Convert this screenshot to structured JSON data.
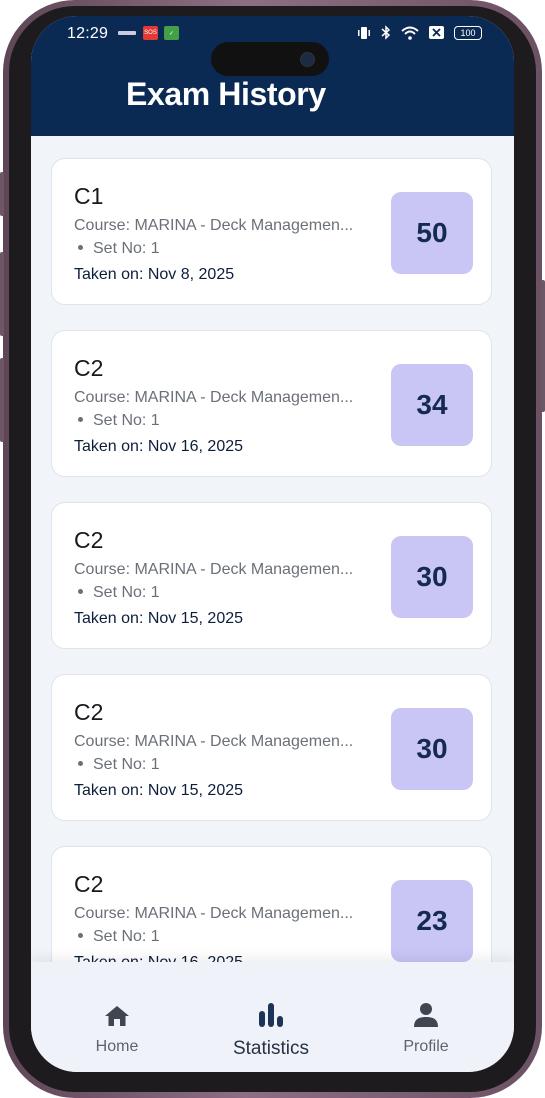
{
  "status_bar": {
    "time": "12:29",
    "battery": "100"
  },
  "header": {
    "title": "Exam History"
  },
  "exams": [
    {
      "name": "C1",
      "course": "Course: MARINA - Deck Managemen...",
      "set": "Set No: 1",
      "taken": "Taken on: Nov 8, 2025",
      "score": "50"
    },
    {
      "name": "C2",
      "course": "Course: MARINA - Deck Managemen...",
      "set": "Set No: 1",
      "taken": "Taken on: Nov 16, 2025",
      "score": "34"
    },
    {
      "name": "C2",
      "course": "Course: MARINA - Deck Managemen...",
      "set": "Set No: 1",
      "taken": "Taken on: Nov 15, 2025",
      "score": "30"
    },
    {
      "name": "C2",
      "course": "Course: MARINA - Deck Managemen...",
      "set": "Set No: 1",
      "taken": "Taken on: Nov 15, 2025",
      "score": "30"
    },
    {
      "name": "C2",
      "course": "Course: MARINA - Deck Managemen...",
      "set": "Set No: 1",
      "taken": "Taken on: Nov 16, 2025",
      "score": "23"
    }
  ],
  "nav": {
    "home": "Home",
    "statistics": "Statistics",
    "profile": "Profile",
    "active": "statistics"
  },
  "colors": {
    "header": "#0a2a54",
    "score_bg": "#c9c5f5",
    "background": "#f1f4f9"
  }
}
